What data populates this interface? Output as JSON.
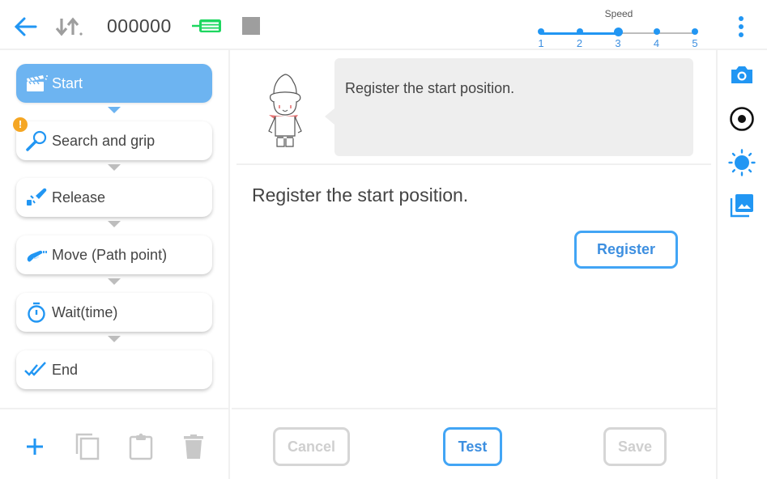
{
  "topbar": {
    "back_icon": "arrow-left-icon",
    "sort_icon": "sort-arrows-icon",
    "counter": "000000",
    "flow_icon": "flow-list-icon",
    "stop_icon": "stop-square-icon",
    "speed": {
      "label": "Speed",
      "levels": [
        "1",
        "2",
        "3",
        "4",
        "5"
      ],
      "selected": 3
    },
    "more_icon": "more-vert-icon"
  },
  "steps": [
    {
      "label": "Start",
      "icon": "clapperboard-icon",
      "active": true,
      "warning": false
    },
    {
      "label": "Search and grip",
      "icon": "magnifier-icon",
      "active": false,
      "warning": true
    },
    {
      "label": "Release",
      "icon": "gripper-release-icon",
      "active": false,
      "warning": false
    },
    {
      "label": "Move (Path point)",
      "icon": "gripper-move-icon",
      "active": false,
      "warning": false
    },
    {
      "label": "Wait(time)",
      "icon": "stopwatch-icon",
      "active": false,
      "warning": false
    },
    {
      "label": "End",
      "icon": "double-check-icon",
      "active": false,
      "warning": false
    }
  ],
  "warning_glyph": "!",
  "left_footer": {
    "add_icon": "plus-icon",
    "copy_icon": "copy-icon",
    "paste_icon": "clipboard-icon",
    "delete_icon": "trash-icon"
  },
  "main": {
    "bubble_text": "Register the start position.",
    "instruction": "Register the start position.",
    "register_label": "Register"
  },
  "footer": {
    "cancel_label": "Cancel",
    "test_label": "Test",
    "save_label": "Save"
  },
  "right_toolbar": {
    "icons": [
      "camera-icon",
      "record-icon",
      "brightness-icon",
      "gallery-icon"
    ]
  },
  "colors": {
    "accent": "#2196f3",
    "active_step": "#6db4f1",
    "flow_green": "#1ed760",
    "warning": "#f5a623",
    "disabled": "#d6d6d6"
  }
}
